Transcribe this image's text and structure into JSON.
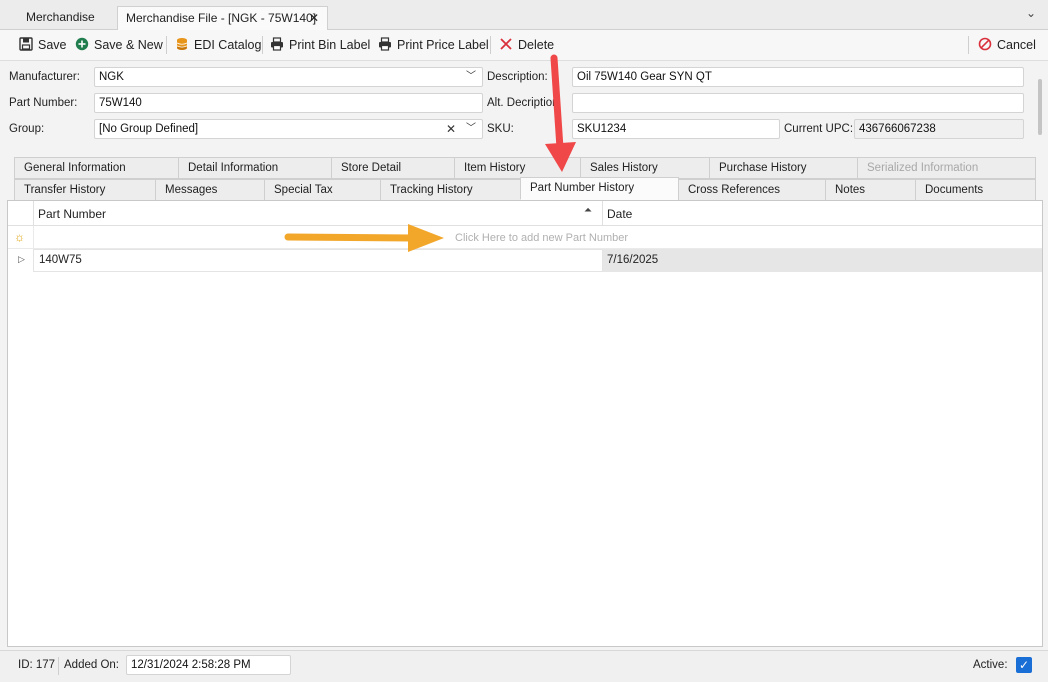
{
  "doc_tabs": [
    {
      "label": "Merchandise"
    },
    {
      "label": "Merchandise File - [NGK - 75W140]",
      "close": "✕"
    }
  ],
  "toolbar": {
    "save": "Save",
    "save_new": "Save & New",
    "edi_catalog": "EDI Catalog",
    "print_bin": "Print Bin Label",
    "print_price": "Print Price Label",
    "delete": "Delete",
    "cancel": "Cancel"
  },
  "form": {
    "manufacturer_label": "Manufacturer:",
    "manufacturer_value": "NGK",
    "part_number_label": "Part Number:",
    "part_number_value": "75W140",
    "group_label": "Group:",
    "group_value": "[No Group Defined]",
    "description_label": "Description:",
    "description_value": "Oil 75W140 Gear SYN QT",
    "alt_description_label": "Alt. Decription:",
    "alt_description_value": "",
    "sku_label": "SKU:",
    "sku_value": "SKU1234",
    "current_upc_label": "Current UPC:",
    "current_upc_value": "436766067238"
  },
  "tabs_row1": [
    "General Information",
    "Detail Information",
    "Store Detail",
    "Item History",
    "Sales History",
    "Purchase History",
    "Serialized Information"
  ],
  "tabs_row2": [
    "Transfer History",
    "Messages",
    "Special Tax",
    "Tracking History",
    "Part Number History",
    "Cross References",
    "Notes",
    "Documents"
  ],
  "grid": {
    "columns": [
      "Part Number",
      "Date"
    ],
    "new_row_hint": "Click Here to add new Part Number",
    "rows": [
      {
        "part_number": "140W75",
        "date": "7/16/2025"
      }
    ]
  },
  "status": {
    "id": "ID: 177",
    "added_on_label": "Added On:",
    "added_on_value": "12/31/2024 2:58:28 PM",
    "active_label": "Active:"
  },
  "colors": {
    "accent": "#1a6fd6",
    "delete_red": "#d9303c",
    "callout_red": "#f04848",
    "callout_orange": "#f2a72b"
  }
}
